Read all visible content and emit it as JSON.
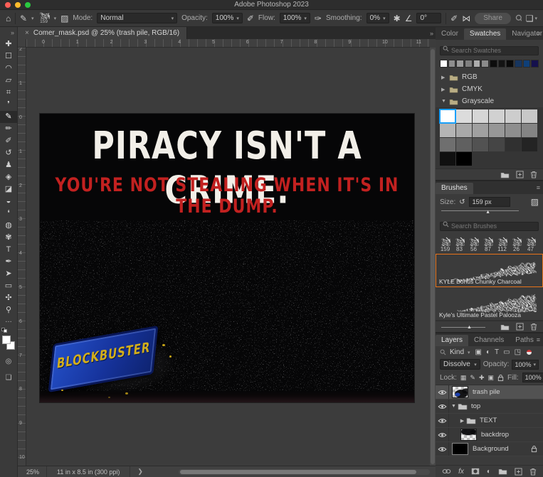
{
  "titlebar": {
    "title": "Adobe Photoshop 2023"
  },
  "options_bar": {
    "brush_size_preview": "159",
    "mode_label": "Mode:",
    "mode_value": "Normal",
    "opacity_label": "Opacity:",
    "opacity_value": "100%",
    "flow_label": "Flow:",
    "flow_value": "100%",
    "smoothing_label": "Smoothing:",
    "smoothing_value": "0%",
    "angle_value": "0°",
    "share_label": "Share"
  },
  "document_tab": {
    "close": "×",
    "title": "Comer_mask.psd @ 25% (trash pile, RGB/16)"
  },
  "toolbar": {
    "tools": [
      {
        "name": "move-tool",
        "glyph": "✚",
        "selected": false
      },
      {
        "name": "marquee-tool",
        "glyph": "☐",
        "selected": false
      },
      {
        "name": "lasso-tool",
        "glyph": "◠",
        "selected": false
      },
      {
        "name": "object-selection-tool",
        "glyph": "▱",
        "selected": false
      },
      {
        "name": "crop-tool",
        "glyph": "⌗",
        "selected": false
      },
      {
        "name": "eyedropper-tool",
        "glyph": "❜",
        "selected": false
      },
      {
        "name": "brush-tool",
        "glyph": "✎",
        "selected": true
      },
      {
        "name": "pencil-tool",
        "glyph": "✏",
        "selected": false
      },
      {
        "name": "mixer-brush-tool",
        "glyph": "✐",
        "selected": false
      },
      {
        "name": "history-brush-tool",
        "glyph": "↺",
        "selected": false
      },
      {
        "name": "clone-stamp-tool",
        "glyph": "♟",
        "selected": false
      },
      {
        "name": "pattern-stamp-tool",
        "glyph": "◈",
        "selected": false
      },
      {
        "name": "eraser-tool",
        "glyph": "◪",
        "selected": false
      },
      {
        "name": "paint-bucket-tool",
        "glyph": "◒",
        "selected": false
      },
      {
        "name": "blur-tool",
        "glyph": "❛",
        "selected": false
      },
      {
        "name": "dodge-tool",
        "glyph": "◍",
        "selected": false
      },
      {
        "name": "smudge-tool",
        "glyph": "✾",
        "selected": false
      },
      {
        "name": "type-tool",
        "glyph": "T",
        "selected": false
      },
      {
        "name": "pen-tool",
        "glyph": "✒",
        "selected": false
      },
      {
        "name": "path-selection-tool",
        "glyph": "➤",
        "selected": false
      },
      {
        "name": "rectangle-tool",
        "glyph": "▭",
        "selected": false
      },
      {
        "name": "hand-tool",
        "glyph": "✣",
        "selected": false
      },
      {
        "name": "zoom-tool",
        "glyph": "⚲",
        "selected": false
      }
    ],
    "more_glyph": "…",
    "quick_mask_glyph": "◎",
    "screen_mode_glyph": "❏"
  },
  "rulers": {
    "horizontal": [
      "0",
      "1",
      "2",
      "3",
      "4",
      "5",
      "6",
      "7",
      "8",
      "9",
      "10",
      "11"
    ],
    "vertical": [
      "2",
      "1",
      "0",
      "1",
      "2",
      "3",
      "4",
      "5",
      "6",
      "7",
      "8",
      "9",
      "10"
    ]
  },
  "canvas": {
    "headline": "PIRACY ISN'T A CRIME.",
    "subheadline": "YOU'RE NOT STEALING WHEN IT'S IN THE DUMP.",
    "card_text": "BLOCKBUSTER",
    "headline_color": "#f2efe8",
    "subheadline_color": "#c22120",
    "card_color": "#16339c",
    "card_text_color": "#d3ae1a"
  },
  "swatches_panel": {
    "tabs": [
      {
        "label": "Color",
        "active": false
      },
      {
        "label": "Swatches",
        "active": true
      },
      {
        "label": "Navigator",
        "active": false
      }
    ],
    "search_placeholder": "Search Swatches",
    "recent_swatches": [
      "#ffffff",
      "#8e8e8e",
      "#9b9b9b",
      "#7f7f7f",
      "#adadad",
      "#8b8b8b",
      "#0d0d0d",
      "#141414",
      "#090909",
      "#17355e",
      "#0f3f78",
      "#15104d"
    ],
    "groups": [
      {
        "label": "RGB",
        "expanded": false
      },
      {
        "label": "CMYK",
        "expanded": false
      },
      {
        "label": "Grayscale",
        "expanded": true
      }
    ],
    "grid_rows": [
      [
        "#ffffff",
        "#dcdcdc",
        "#d6d6d6",
        "#d1d1d1",
        "#cdcdcd",
        "#c8c8c8"
      ],
      [
        "#b5b5b5",
        "#a9a9a9",
        "#a0a0a0",
        "#979797",
        "#8e8e8e",
        "#858585"
      ],
      [
        "#6f6f6f",
        "#606060",
        "#525252",
        "#454545",
        "#303030",
        "#242424"
      ],
      [
        "#101010",
        "#000000"
      ]
    ],
    "selected_swatch": "#ffffff",
    "selection_color": "#18a0fb"
  },
  "brushes_panel": {
    "title": "Brushes",
    "size_label": "Size:",
    "size_value": "159 px",
    "search_placeholder": "Search Brushes",
    "tip_sizes": [
      "159",
      "83",
      "56",
      "87",
      "112",
      "26",
      "47"
    ],
    "presets": [
      {
        "name": "KYLE Bonus Chunky Charcoal",
        "selected": true
      },
      {
        "name": "Kyle's Ultimate Pastel Palooza",
        "selected": false
      }
    ],
    "selection_color": "#e8731a"
  },
  "layers_panel": {
    "tabs": [
      {
        "label": "Layers",
        "active": true
      },
      {
        "label": "Channels",
        "active": false
      },
      {
        "label": "Paths",
        "active": false
      }
    ],
    "filter_label": "Kind",
    "blend_mode": "Dissolve",
    "opacity_label": "Opacity:",
    "opacity_value": "100%",
    "lock_label": "Lock:",
    "fill_label": "Fill:",
    "fill_value": "100%",
    "layers": [
      {
        "name": "trash pile",
        "kind": "pixel-trash",
        "indent": 0,
        "selected": true,
        "locked": false
      },
      {
        "name": "top",
        "kind": "group-open",
        "indent": 0,
        "selected": false,
        "locked": false
      },
      {
        "name": "TEXT",
        "kind": "group-closed",
        "indent": 1,
        "selected": false,
        "locked": false
      },
      {
        "name": "backdrop",
        "kind": "pixel-backdrop",
        "indent": 1,
        "selected": false,
        "locked": false
      },
      {
        "name": "Background",
        "kind": "background",
        "indent": 0,
        "selected": false,
        "locked": true
      }
    ]
  },
  "status_bar": {
    "zoom_level": "25%",
    "document_info": "11 in x 8.5 in (300 ppi)",
    "chevron": "❯"
  }
}
